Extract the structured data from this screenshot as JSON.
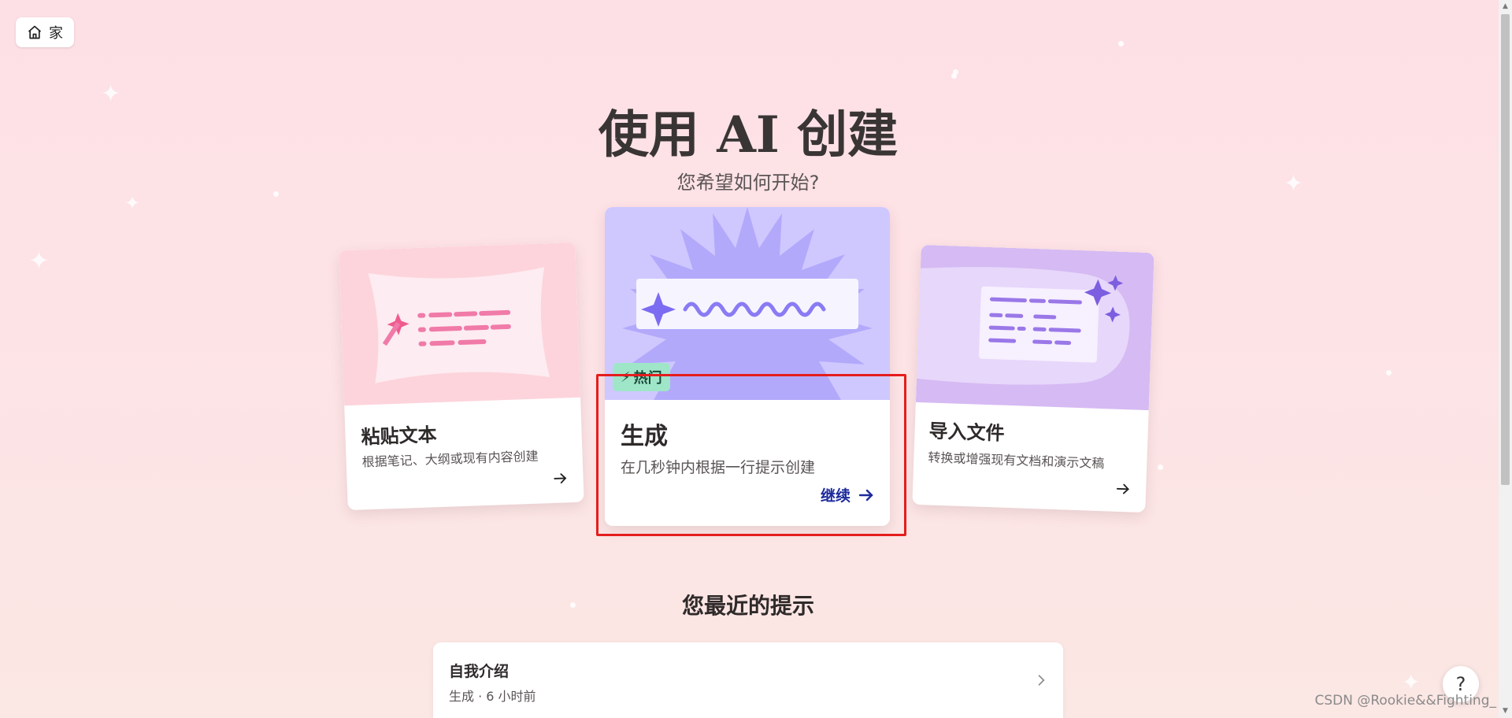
{
  "header": {
    "home_label": "家"
  },
  "hero": {
    "title": "使用 AI 创建",
    "subtitle": "您希望如何开始?"
  },
  "cards": {
    "paste": {
      "title": "粘贴文本",
      "desc": "根据笔记、大纲或现有内容创建"
    },
    "generate": {
      "badge": "热门",
      "title": "生成",
      "desc": "在几秒钟内根据一行提示创建",
      "continue_label": "继续"
    },
    "import": {
      "title": "导入文件",
      "desc": "转换或增强现有文档和演示文稿"
    }
  },
  "recent": {
    "section_title": "您最近的提示",
    "items": [
      {
        "title": "自我介绍",
        "meta": "生成 · 6 小时前"
      }
    ]
  },
  "help": {
    "label": "?"
  },
  "watermark": "CSDN @Rookie&&Fighting_",
  "colors": {
    "highlight": "#e51d1d",
    "continue": "#1c2a9c",
    "badge_bg": "#9fe6c9",
    "generate_art": "#cfc8ff",
    "paste_art": "#fdd4dc",
    "import_art": "#d6baf3"
  }
}
